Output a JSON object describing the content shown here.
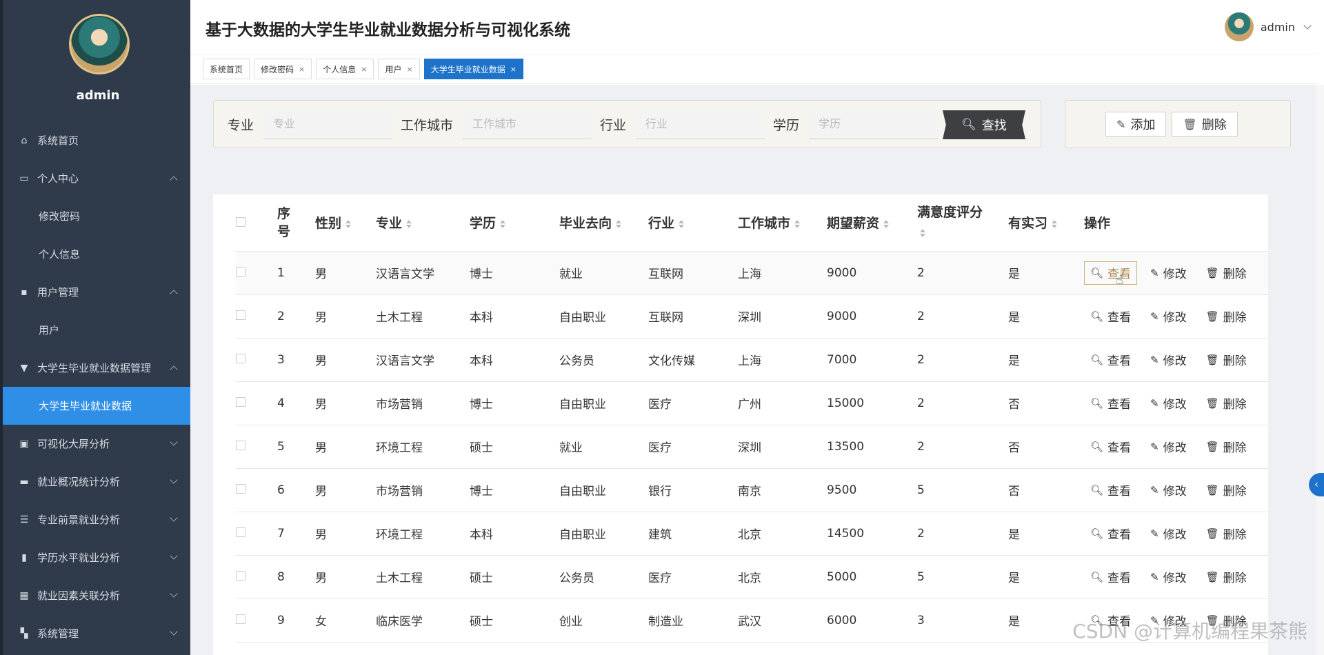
{
  "sidebar": {
    "username": "admin",
    "items": [
      {
        "label": "系统首页",
        "icon": "home-icon"
      },
      {
        "label": "个人中心",
        "icon": "user-card-icon",
        "expanded": true
      },
      {
        "label": "修改密码",
        "sub": true
      },
      {
        "label": "个人信息",
        "sub": true
      },
      {
        "label": "用户管理",
        "icon": "user-manage-icon",
        "expanded": true
      },
      {
        "label": "用户",
        "sub": true
      },
      {
        "label": "大学生毕业就业数据管理",
        "icon": "data-manage-icon",
        "expanded": true
      },
      {
        "label": "大学生毕业就业数据",
        "sub": true,
        "active": true
      },
      {
        "label": "可视化大屏分析",
        "icon": "screen-icon",
        "expanded": false
      },
      {
        "label": "就业概况统计分析",
        "icon": "stats-icon",
        "expanded": false
      },
      {
        "label": "专业前景就业分析",
        "icon": "sliders-icon",
        "expanded": false
      },
      {
        "label": "学历水平就业分析",
        "icon": "book-icon",
        "expanded": false
      },
      {
        "label": "就业因素关联分析",
        "icon": "grid-icon",
        "expanded": false
      },
      {
        "label": "系统管理",
        "icon": "apps-icon",
        "expanded": false
      }
    ]
  },
  "header": {
    "title": "基于大数据的大学生毕业就业数据分析与可视化系统",
    "username": "admin"
  },
  "tabs": [
    {
      "label": "系统首页",
      "closable": false,
      "active": false
    },
    {
      "label": "修改密码",
      "closable": true,
      "active": false
    },
    {
      "label": "个人信息",
      "closable": true,
      "active": false
    },
    {
      "label": "用户",
      "closable": true,
      "active": false
    },
    {
      "label": "大学生毕业就业数据",
      "closable": true,
      "active": true
    }
  ],
  "tab_close": "×",
  "search": {
    "fields": [
      {
        "label": "专业",
        "placeholder": "专业"
      },
      {
        "label": "工作城市",
        "placeholder": "工作城市"
      },
      {
        "label": "行业",
        "placeholder": "行业"
      },
      {
        "label": "学历",
        "placeholder": "学历"
      }
    ],
    "find_label": "查找"
  },
  "actions": {
    "add_label": "添加",
    "delete_label": "删除"
  },
  "table": {
    "columns": [
      "序号",
      "性别",
      "专业",
      "学历",
      "毕业去向",
      "行业",
      "工作城市",
      "期望薪资",
      "满意度评分",
      "有实习",
      "操作"
    ],
    "rows": [
      [
        "1",
        "男",
        "汉语言文学",
        "博士",
        "就业",
        "互联网",
        "上海",
        "9000",
        "2",
        "是"
      ],
      [
        "2",
        "男",
        "土木工程",
        "本科",
        "自由职业",
        "互联网",
        "深圳",
        "9000",
        "2",
        "是"
      ],
      [
        "3",
        "男",
        "汉语言文学",
        "本科",
        "公务员",
        "文化传媒",
        "上海",
        "7000",
        "2",
        "是"
      ],
      [
        "4",
        "男",
        "市场营销",
        "博士",
        "自由职业",
        "医疗",
        "广州",
        "15000",
        "2",
        "否"
      ],
      [
        "5",
        "男",
        "环境工程",
        "硕士",
        "就业",
        "医疗",
        "深圳",
        "13500",
        "2",
        "否"
      ],
      [
        "6",
        "男",
        "市场营销",
        "博士",
        "自由职业",
        "银行",
        "南京",
        "9500",
        "5",
        "否"
      ],
      [
        "7",
        "男",
        "环境工程",
        "本科",
        "自由职业",
        "建筑",
        "北京",
        "14500",
        "2",
        "是"
      ],
      [
        "8",
        "男",
        "土木工程",
        "硕士",
        "公务员",
        "医疗",
        "北京",
        "5000",
        "5",
        "是"
      ],
      [
        "9",
        "女",
        "临床医学",
        "硕士",
        "创业",
        "制造业",
        "武汉",
        "6000",
        "3",
        "是"
      ]
    ],
    "op_view": "查看",
    "op_edit": "修改",
    "op_delete": "删除"
  },
  "watermark": "CSDN @计算机编程果茶熊"
}
